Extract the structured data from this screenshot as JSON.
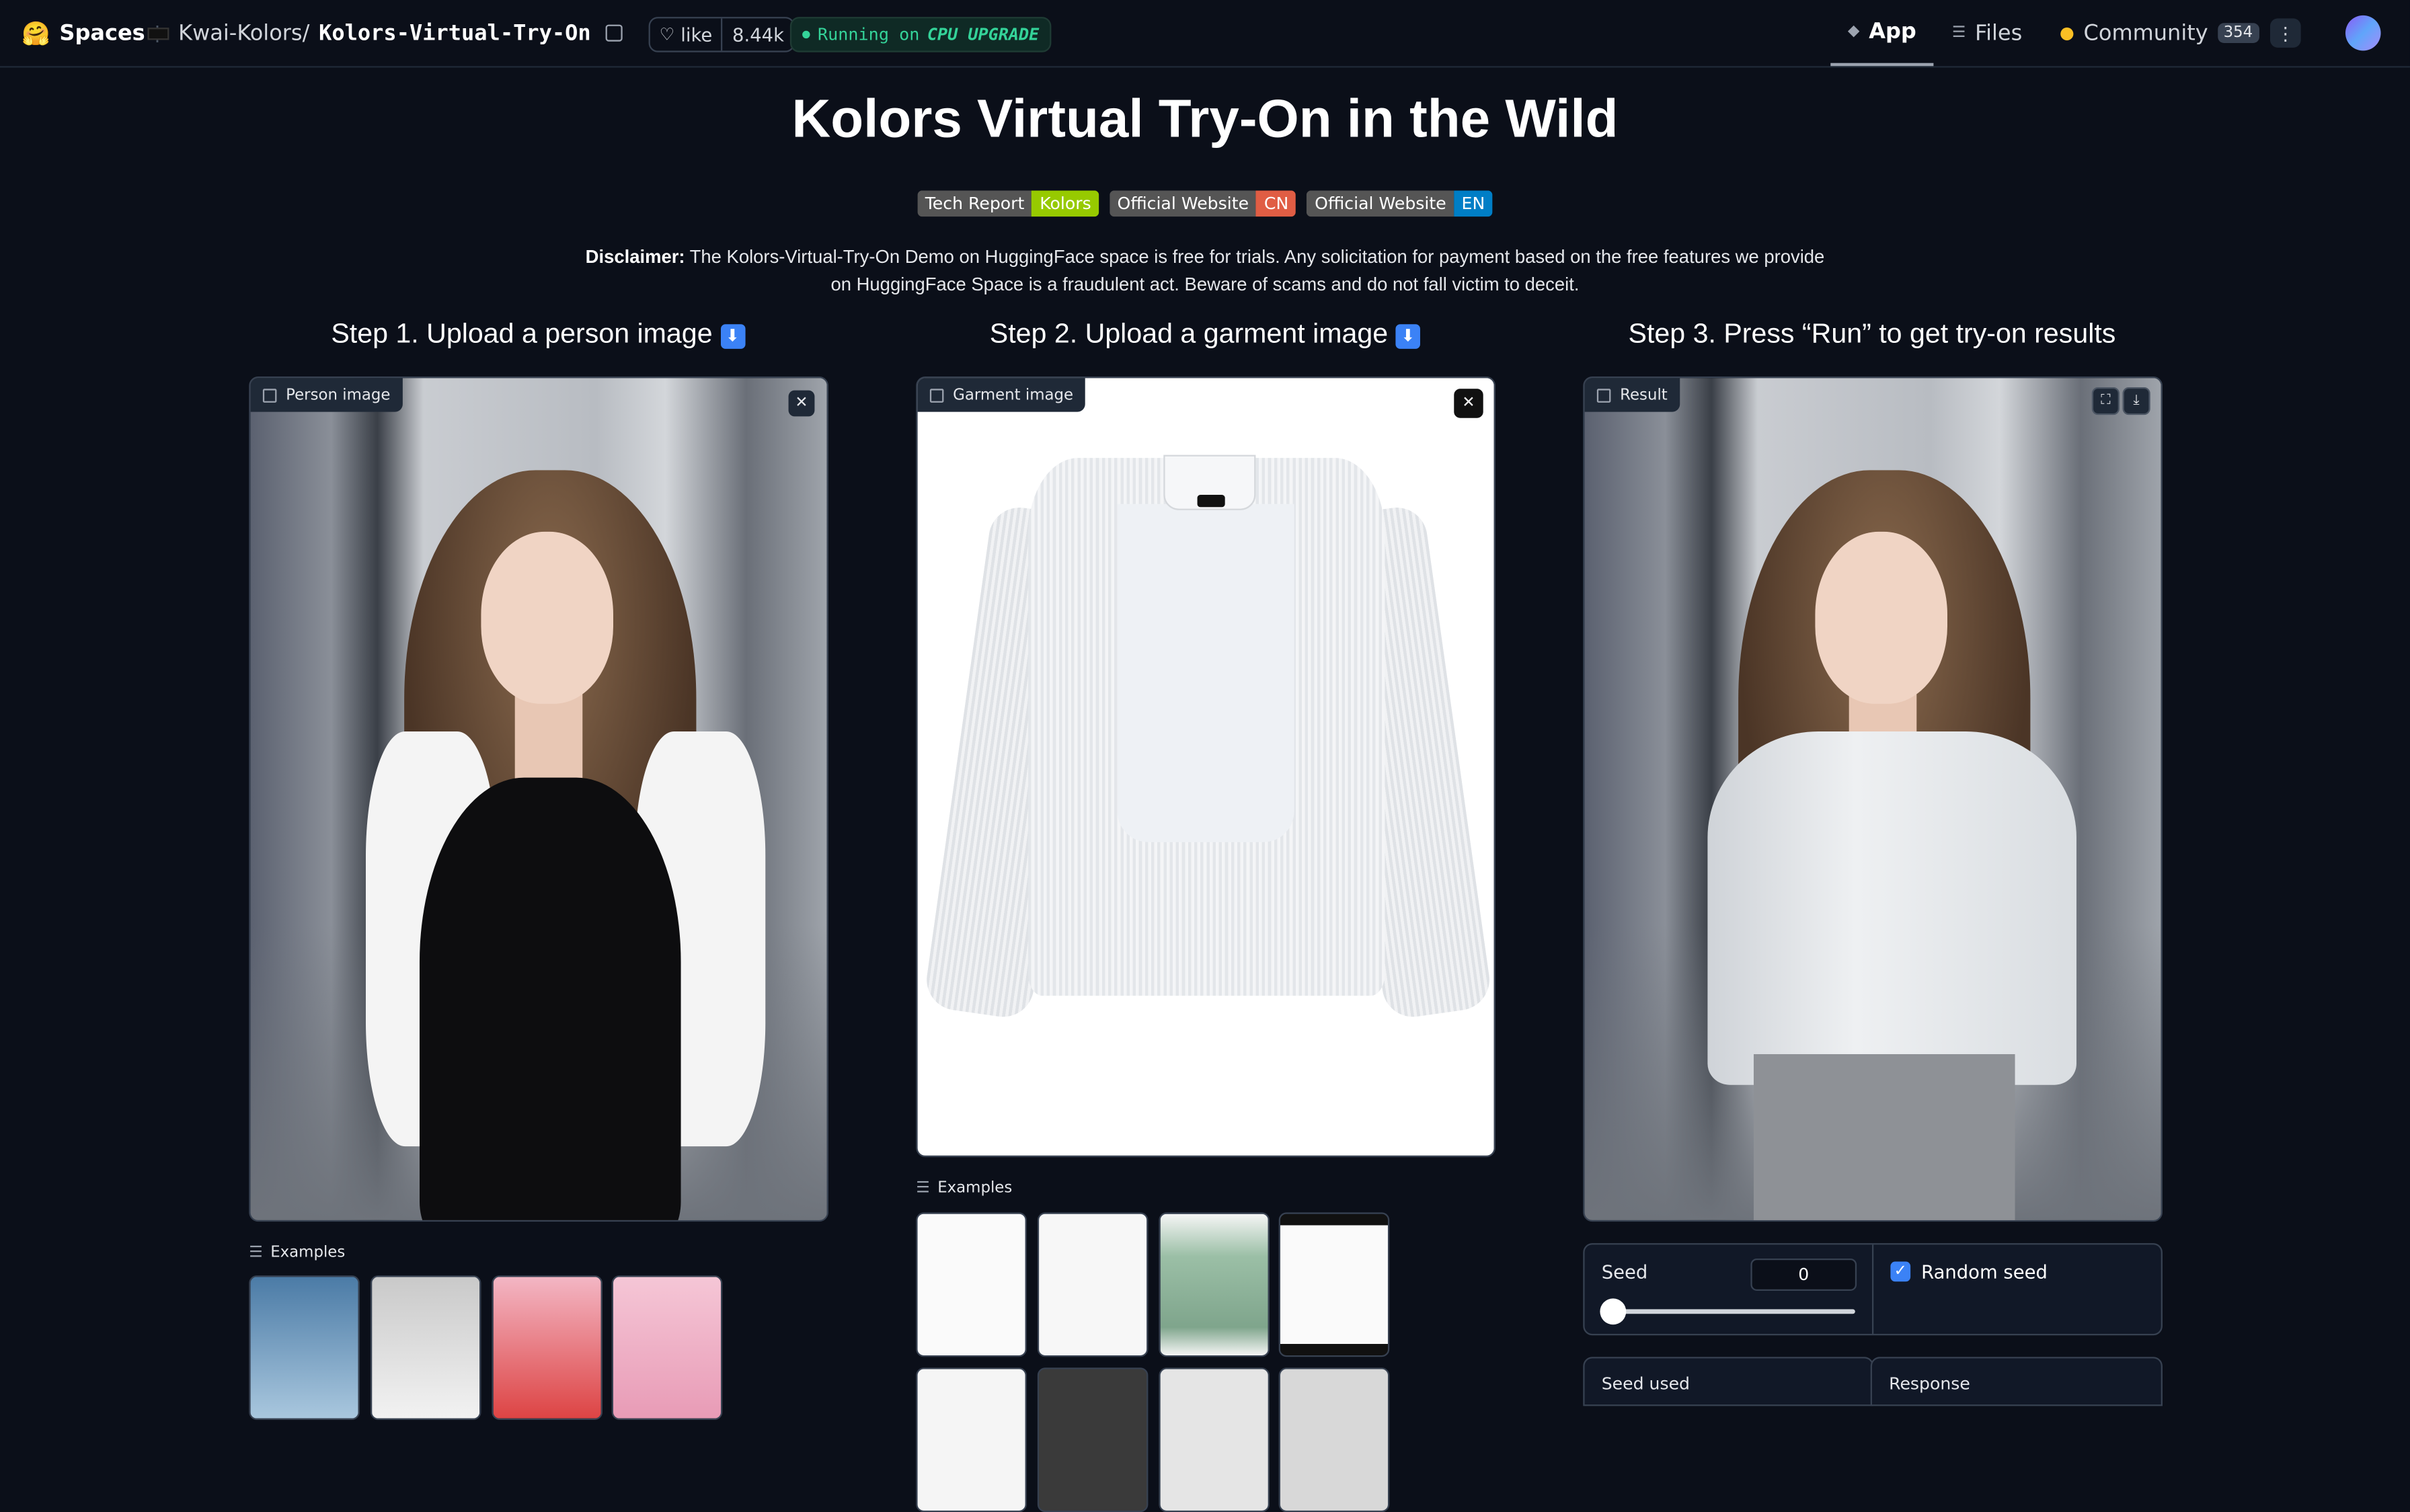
{
  "topbar": {
    "spaces_label": "Spaces",
    "org": "Kwai-Kolors/",
    "repo": "Kolors-Virtual-Try-On",
    "like_label": "like",
    "like_count": "8.44k",
    "status_prefix": "Running on",
    "status_hw": "CPU UPGRADE",
    "tabs": [
      {
        "label": "App",
        "active": true
      },
      {
        "label": "Files",
        "active": false
      },
      {
        "label": "Community",
        "active": false,
        "badge": "354"
      }
    ]
  },
  "header": {
    "title": "Kolors Virtual Try-On in the Wild",
    "badges": [
      {
        "left": "Tech Report",
        "right": "Kolors",
        "color": "#97ca00"
      },
      {
        "left": "Official Website",
        "right": "CN",
        "color": "#e05d44"
      },
      {
        "left": "Official Website",
        "right": "EN",
        "color": "#007ec6"
      }
    ],
    "disclaimer_bold": "Disclaimer:",
    "disclaimer_text": " The Kolors-Virtual-Try-On Demo on HuggingFace space is free for trials. Any solicitation for payment based on the free features we provide on HuggingFace Space is a fraudulent act. Beware of scams and do not fall victim to deceit."
  },
  "steps": {
    "step1": "Step 1. Upload a person image",
    "step2": "Step 2. Upload a garment image",
    "step3": "Step 3. Press “Run” to get try-on results"
  },
  "panels": {
    "person_label": "Person image",
    "garment_label": "Garment image",
    "result_label": "Result",
    "examples_label": "Examples"
  },
  "seed": {
    "label": "Seed",
    "value": "0",
    "slider_fraction": 0,
    "random_label": "Random seed",
    "random_checked": true
  },
  "outputs": {
    "seed_used_label": "Seed used",
    "response_label": "Response"
  },
  "colors": {
    "background": "#0b0f19",
    "panel": "#111827",
    "border": "#374151",
    "status_green": "#34d399",
    "checkbox_blue": "#3b82f6"
  }
}
